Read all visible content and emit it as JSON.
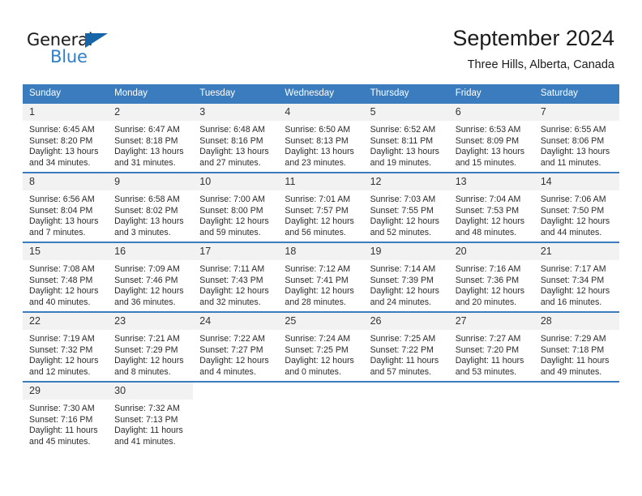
{
  "brand": {
    "name_top": "General",
    "name_bottom": "Blue",
    "triangle_color": "#1565a8",
    "blue_color": "#2f80c8"
  },
  "header": {
    "title": "September 2024",
    "subtitle": "Three Hills, Alberta, Canada"
  },
  "theme": {
    "header_blue": "#3a7cbe",
    "daynum_bg": "#f2f2f2",
    "text": "#2b2b2b"
  },
  "weekday_headers": [
    "Sunday",
    "Monday",
    "Tuesday",
    "Wednesday",
    "Thursday",
    "Friday",
    "Saturday"
  ],
  "labels": {
    "sunrise_prefix": "Sunrise:",
    "sunset_prefix": "Sunset:",
    "daylight_prefix": "Daylight:"
  },
  "weeks": [
    [
      {
        "day": "1",
        "sunrise": "Sunrise: 6:45 AM",
        "sunset": "Sunset: 8:20 PM",
        "daylight_1": "Daylight: 13 hours",
        "daylight_2": "and 34 minutes."
      },
      {
        "day": "2",
        "sunrise": "Sunrise: 6:47 AM",
        "sunset": "Sunset: 8:18 PM",
        "daylight_1": "Daylight: 13 hours",
        "daylight_2": "and 31 minutes."
      },
      {
        "day": "3",
        "sunrise": "Sunrise: 6:48 AM",
        "sunset": "Sunset: 8:16 PM",
        "daylight_1": "Daylight: 13 hours",
        "daylight_2": "and 27 minutes."
      },
      {
        "day": "4",
        "sunrise": "Sunrise: 6:50 AM",
        "sunset": "Sunset: 8:13 PM",
        "daylight_1": "Daylight: 13 hours",
        "daylight_2": "and 23 minutes."
      },
      {
        "day": "5",
        "sunrise": "Sunrise: 6:52 AM",
        "sunset": "Sunset: 8:11 PM",
        "daylight_1": "Daylight: 13 hours",
        "daylight_2": "and 19 minutes."
      },
      {
        "day": "6",
        "sunrise": "Sunrise: 6:53 AM",
        "sunset": "Sunset: 8:09 PM",
        "daylight_1": "Daylight: 13 hours",
        "daylight_2": "and 15 minutes."
      },
      {
        "day": "7",
        "sunrise": "Sunrise: 6:55 AM",
        "sunset": "Sunset: 8:06 PM",
        "daylight_1": "Daylight: 13 hours",
        "daylight_2": "and 11 minutes."
      }
    ],
    [
      {
        "day": "8",
        "sunrise": "Sunrise: 6:56 AM",
        "sunset": "Sunset: 8:04 PM",
        "daylight_1": "Daylight: 13 hours",
        "daylight_2": "and 7 minutes."
      },
      {
        "day": "9",
        "sunrise": "Sunrise: 6:58 AM",
        "sunset": "Sunset: 8:02 PM",
        "daylight_1": "Daylight: 13 hours",
        "daylight_2": "and 3 minutes."
      },
      {
        "day": "10",
        "sunrise": "Sunrise: 7:00 AM",
        "sunset": "Sunset: 8:00 PM",
        "daylight_1": "Daylight: 12 hours",
        "daylight_2": "and 59 minutes."
      },
      {
        "day": "11",
        "sunrise": "Sunrise: 7:01 AM",
        "sunset": "Sunset: 7:57 PM",
        "daylight_1": "Daylight: 12 hours",
        "daylight_2": "and 56 minutes."
      },
      {
        "day": "12",
        "sunrise": "Sunrise: 7:03 AM",
        "sunset": "Sunset: 7:55 PM",
        "daylight_1": "Daylight: 12 hours",
        "daylight_2": "and 52 minutes."
      },
      {
        "day": "13",
        "sunrise": "Sunrise: 7:04 AM",
        "sunset": "Sunset: 7:53 PM",
        "daylight_1": "Daylight: 12 hours",
        "daylight_2": "and 48 minutes."
      },
      {
        "day": "14",
        "sunrise": "Sunrise: 7:06 AM",
        "sunset": "Sunset: 7:50 PM",
        "daylight_1": "Daylight: 12 hours",
        "daylight_2": "and 44 minutes."
      }
    ],
    [
      {
        "day": "15",
        "sunrise": "Sunrise: 7:08 AM",
        "sunset": "Sunset: 7:48 PM",
        "daylight_1": "Daylight: 12 hours",
        "daylight_2": "and 40 minutes."
      },
      {
        "day": "16",
        "sunrise": "Sunrise: 7:09 AM",
        "sunset": "Sunset: 7:46 PM",
        "daylight_1": "Daylight: 12 hours",
        "daylight_2": "and 36 minutes."
      },
      {
        "day": "17",
        "sunrise": "Sunrise: 7:11 AM",
        "sunset": "Sunset: 7:43 PM",
        "daylight_1": "Daylight: 12 hours",
        "daylight_2": "and 32 minutes."
      },
      {
        "day": "18",
        "sunrise": "Sunrise: 7:12 AM",
        "sunset": "Sunset: 7:41 PM",
        "daylight_1": "Daylight: 12 hours",
        "daylight_2": "and 28 minutes."
      },
      {
        "day": "19",
        "sunrise": "Sunrise: 7:14 AM",
        "sunset": "Sunset: 7:39 PM",
        "daylight_1": "Daylight: 12 hours",
        "daylight_2": "and 24 minutes."
      },
      {
        "day": "20",
        "sunrise": "Sunrise: 7:16 AM",
        "sunset": "Sunset: 7:36 PM",
        "daylight_1": "Daylight: 12 hours",
        "daylight_2": "and 20 minutes."
      },
      {
        "day": "21",
        "sunrise": "Sunrise: 7:17 AM",
        "sunset": "Sunset: 7:34 PM",
        "daylight_1": "Daylight: 12 hours",
        "daylight_2": "and 16 minutes."
      }
    ],
    [
      {
        "day": "22",
        "sunrise": "Sunrise: 7:19 AM",
        "sunset": "Sunset: 7:32 PM",
        "daylight_1": "Daylight: 12 hours",
        "daylight_2": "and 12 minutes."
      },
      {
        "day": "23",
        "sunrise": "Sunrise: 7:21 AM",
        "sunset": "Sunset: 7:29 PM",
        "daylight_1": "Daylight: 12 hours",
        "daylight_2": "and 8 minutes."
      },
      {
        "day": "24",
        "sunrise": "Sunrise: 7:22 AM",
        "sunset": "Sunset: 7:27 PM",
        "daylight_1": "Daylight: 12 hours",
        "daylight_2": "and 4 minutes."
      },
      {
        "day": "25",
        "sunrise": "Sunrise: 7:24 AM",
        "sunset": "Sunset: 7:25 PM",
        "daylight_1": "Daylight: 12 hours",
        "daylight_2": "and 0 minutes."
      },
      {
        "day": "26",
        "sunrise": "Sunrise: 7:25 AM",
        "sunset": "Sunset: 7:22 PM",
        "daylight_1": "Daylight: 11 hours",
        "daylight_2": "and 57 minutes."
      },
      {
        "day": "27",
        "sunrise": "Sunrise: 7:27 AM",
        "sunset": "Sunset: 7:20 PM",
        "daylight_1": "Daylight: 11 hours",
        "daylight_2": "and 53 minutes."
      },
      {
        "day": "28",
        "sunrise": "Sunrise: 7:29 AM",
        "sunset": "Sunset: 7:18 PM",
        "daylight_1": "Daylight: 11 hours",
        "daylight_2": "and 49 minutes."
      }
    ],
    [
      {
        "day": "29",
        "sunrise": "Sunrise: 7:30 AM",
        "sunset": "Sunset: 7:16 PM",
        "daylight_1": "Daylight: 11 hours",
        "daylight_2": "and 45 minutes."
      },
      {
        "day": "30",
        "sunrise": "Sunrise: 7:32 AM",
        "sunset": "Sunset: 7:13 PM",
        "daylight_1": "Daylight: 11 hours",
        "daylight_2": "and 41 minutes."
      },
      {
        "day": "",
        "sunrise": "",
        "sunset": "",
        "daylight_1": "",
        "daylight_2": ""
      },
      {
        "day": "",
        "sunrise": "",
        "sunset": "",
        "daylight_1": "",
        "daylight_2": ""
      },
      {
        "day": "",
        "sunrise": "",
        "sunset": "",
        "daylight_1": "",
        "daylight_2": ""
      },
      {
        "day": "",
        "sunrise": "",
        "sunset": "",
        "daylight_1": "",
        "daylight_2": ""
      },
      {
        "day": "",
        "sunrise": "",
        "sunset": "",
        "daylight_1": "",
        "daylight_2": ""
      }
    ]
  ]
}
